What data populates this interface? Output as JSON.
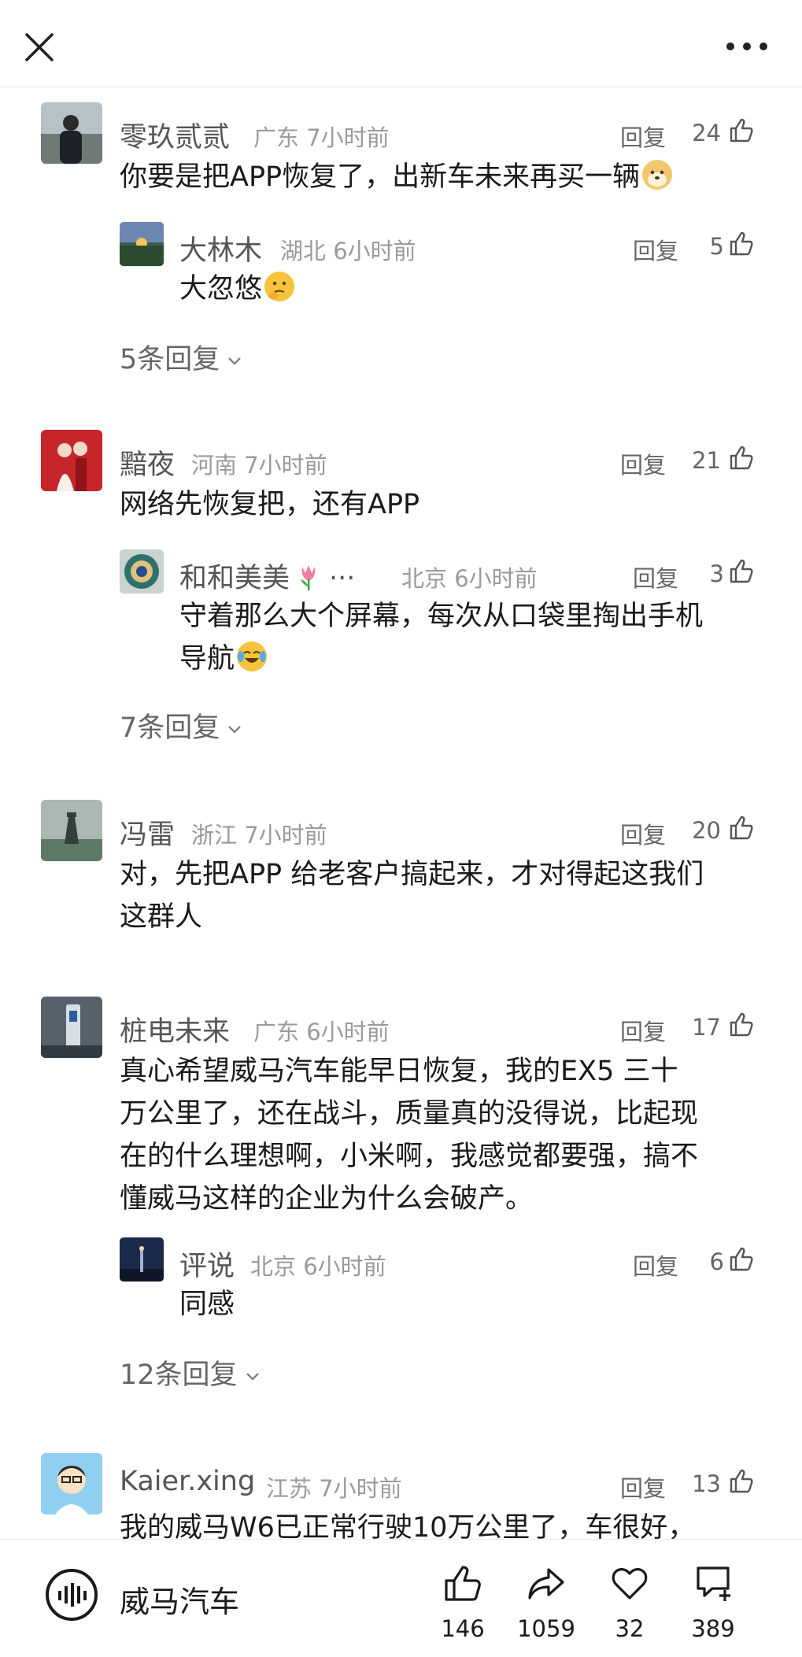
{
  "topbar": {
    "close_icon": "close-icon",
    "more_icon": "more-horizontal-icon"
  },
  "comments": [
    {
      "name": "零玖贰贰",
      "location": "广东",
      "time": "7小时前",
      "reply_label": "回复",
      "likes": "24",
      "text": "你要是把APP恢复了，出新车未来再买一辆",
      "emoji": "doge-emoji",
      "reply": {
        "name": "大林木",
        "location": "湖北",
        "time": "6小时前",
        "reply_label": "回复",
        "likes": "5",
        "text": "大忽悠",
        "emoji": "thinking-emoji"
      },
      "more_replies": "5条回复"
    },
    {
      "name": "黯夜",
      "location": "河南",
      "time": "7小时前",
      "reply_label": "回复",
      "likes": "21",
      "text": "网络先恢复把，还有APP",
      "reply": {
        "name": "和和美美",
        "location": "北京",
        "time": "6小时前",
        "reply_label": "回复",
        "likes": "3",
        "text_line1": "守着那么大个屏幕，每次从口袋里掏出手机",
        "text_line2": "导航",
        "emoji": "laugh-cry-emoji",
        "name_emoji": "tulip-emoji",
        "name_suffix": "···"
      },
      "more_replies": "7条回复"
    },
    {
      "name": "冯雷",
      "location": "浙江",
      "time": "7小时前",
      "reply_label": "回复",
      "likes": "20",
      "text_line1": "对，先把APP 给老客户搞起来，才对得起这我们",
      "text_line2": "这群人"
    },
    {
      "name": "桩电未来",
      "location": "广东",
      "time": "6小时前",
      "reply_label": "回复",
      "likes": "17",
      "text_line1": "真心希望威马汽车能早日恢复，我的EX5  三十",
      "text_line2": "万公里了，还在战斗，质量真的没得说，比起现",
      "text_line3": "在的什么理想啊，小米啊，我感觉都要强，搞不",
      "text_line4": "懂威马这样的企业为什么会破产。",
      "reply": {
        "name": "评说",
        "location": "北京",
        "time": "6小时前",
        "reply_label": "回复",
        "likes": "6",
        "text": "同感"
      },
      "more_replies": "12条回复"
    },
    {
      "name": "Kaier.xing",
      "location": "江苏",
      "time": "7小时前",
      "reply_label": "回复",
      "likes": "13",
      "text": "我的威马W6已正常行驶10万公里了，车很好，"
    }
  ],
  "bottombar": {
    "brand": "威马汽车",
    "actions": [
      {
        "icon": "thumbs-up-icon",
        "count": "146"
      },
      {
        "icon": "share-icon",
        "count": "1059"
      },
      {
        "icon": "heart-icon",
        "count": "32"
      },
      {
        "icon": "comment-add-icon",
        "count": "389"
      }
    ]
  }
}
